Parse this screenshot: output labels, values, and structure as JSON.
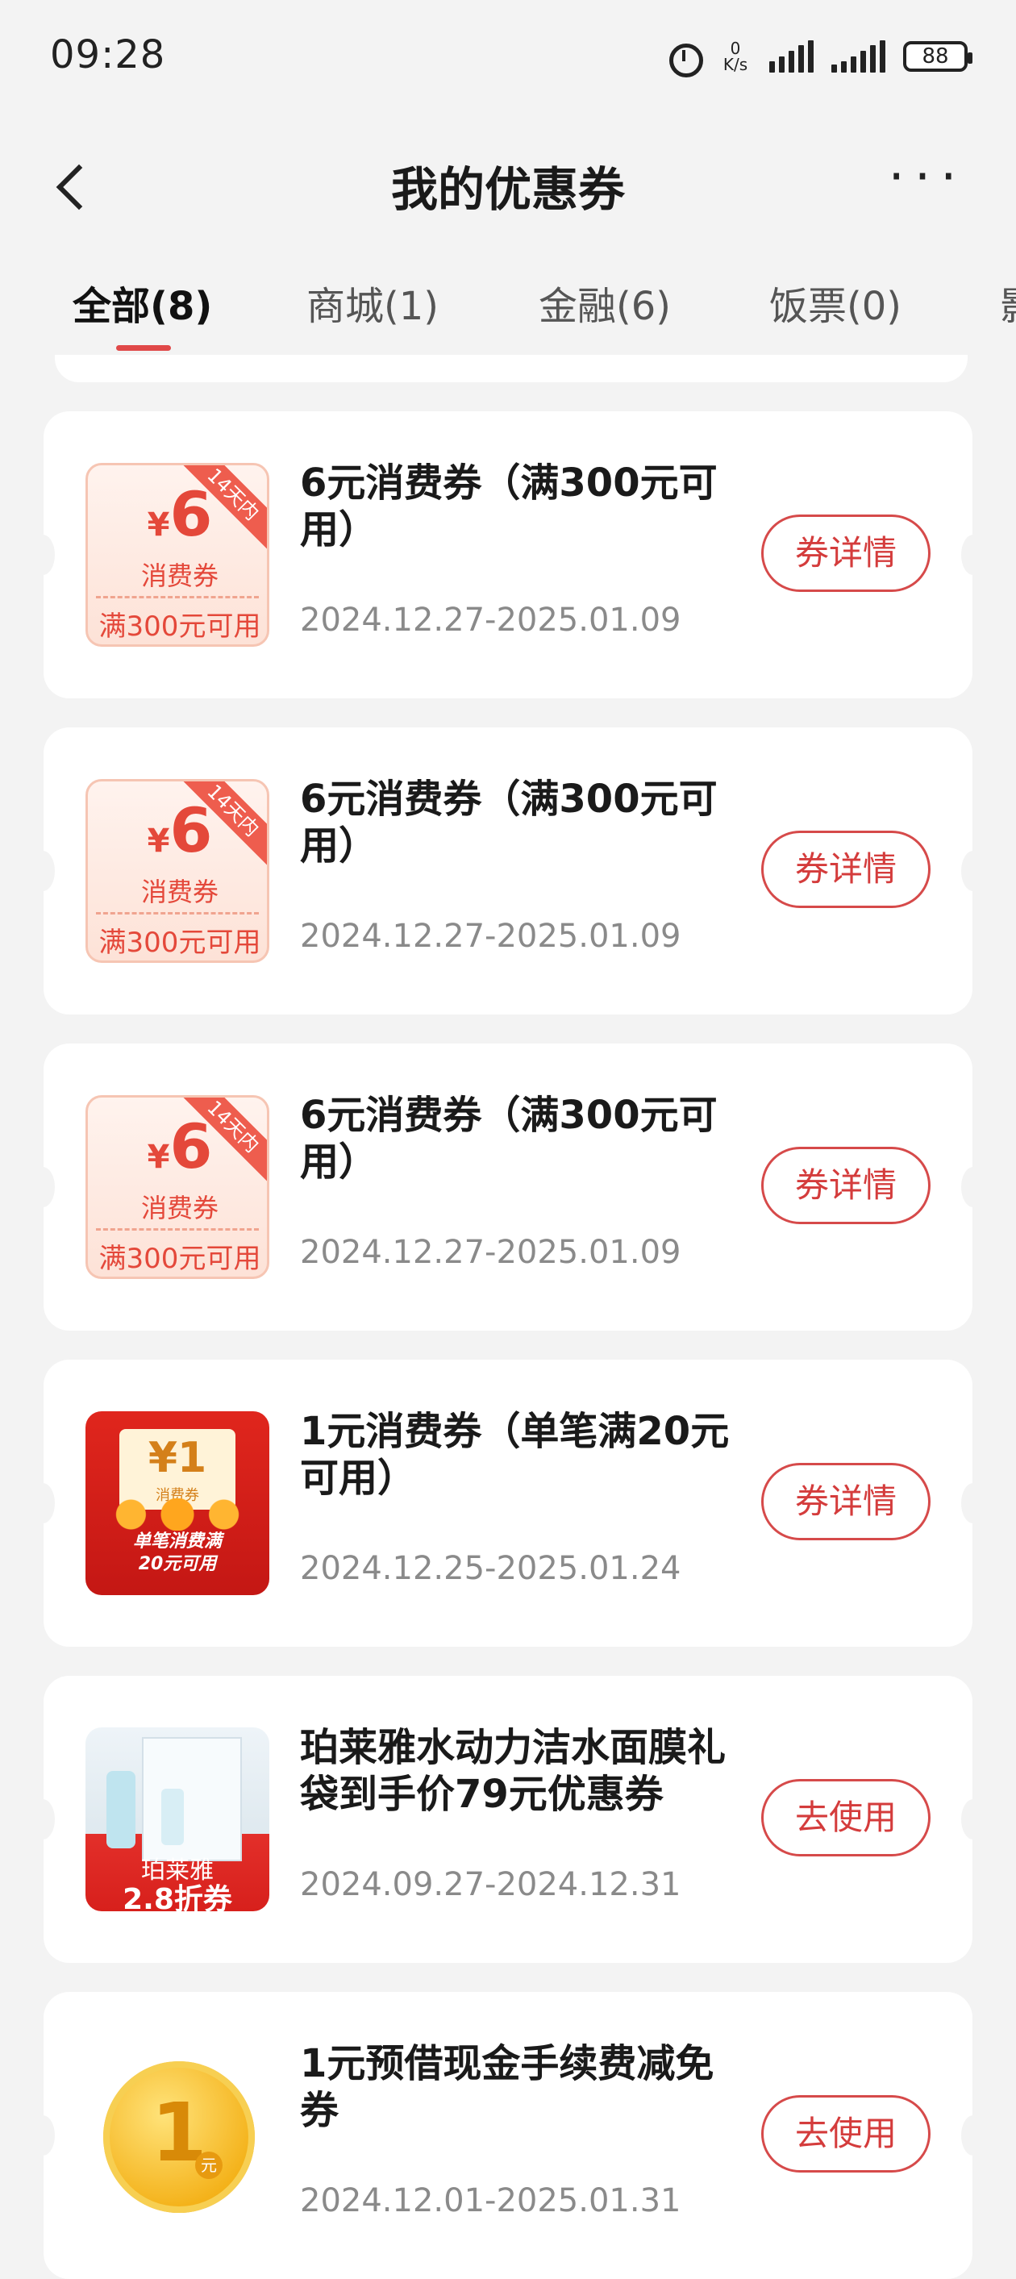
{
  "status_bar": {
    "time": "09:28",
    "net_speed_value": "0",
    "net_speed_unit": "K/s",
    "battery": "88"
  },
  "header": {
    "title": "我的优惠券"
  },
  "tabs": [
    {
      "label": "全部(8)",
      "active": true
    },
    {
      "label": "商城(1)",
      "active": false
    },
    {
      "label": "金融(6)",
      "active": false
    },
    {
      "label": "饭票(0)",
      "active": false
    },
    {
      "label": "影",
      "active": false
    }
  ],
  "coupons": [
    {
      "title": "6元消费券（满300元可用）",
      "date": "2024.12.27-2025.01.09",
      "button": "券详情",
      "thumb": {
        "currency": "¥",
        "amount": "6",
        "kind": "消费券",
        "condition": "满300元可用",
        "ribbon": "14天内"
      }
    },
    {
      "title": "6元消费券（满300元可用）",
      "date": "2024.12.27-2025.01.09",
      "button": "券详情",
      "thumb": {
        "currency": "¥",
        "amount": "6",
        "kind": "消费券",
        "condition": "满300元可用",
        "ribbon": "14天内"
      }
    },
    {
      "title": "6元消费券（满300元可用）",
      "date": "2024.12.27-2025.01.09",
      "button": "券详情",
      "thumb": {
        "currency": "¥",
        "amount": "6",
        "kind": "消费券",
        "condition": "满300元可用",
        "ribbon": "14天内"
      }
    },
    {
      "title": "1元消费券（单笔满20元可用）",
      "date": "2024.12.25-2025.01.24",
      "button": "券详情",
      "thumb": {
        "amount": "¥1",
        "kind": "消费券",
        "line1": "单笔消费满",
        "line2": "20元可用"
      }
    },
    {
      "title": "珀莱雅水动力洁水面膜礼袋到手价79元优惠券",
      "date": "2024.09.27-2024.12.31",
      "button": "去使用",
      "thumb": {
        "brand": "珀莱雅",
        "discount": "2.8折券"
      }
    },
    {
      "title": "1元预借现金手续费减免券",
      "date": "2024.12.01-2025.01.31",
      "button": "去使用",
      "thumb": {
        "amount": "1",
        "unit": "元"
      }
    }
  ],
  "colors": {
    "accent": "#e04848",
    "button_border": "#d64a4a",
    "background": "#f3f3f3"
  }
}
